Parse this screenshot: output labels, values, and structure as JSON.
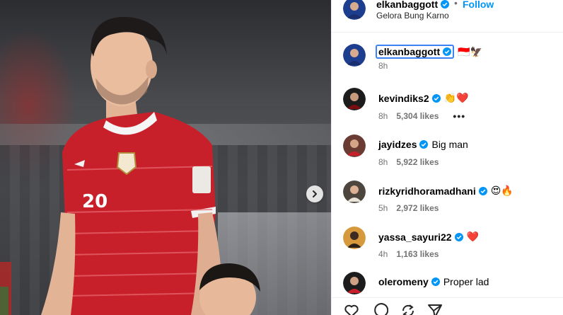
{
  "post": {
    "author": "elkanbaggott",
    "location": "Gelora Bung Karno",
    "follow_label": "Follow",
    "dot": "•",
    "jersey_number": "20",
    "caption_emojis": "🇮🇩🦅",
    "caption_time": "8h"
  },
  "comments": [
    {
      "user": "kevindiks2",
      "text": "👏❤️",
      "time": "8h",
      "likes": "5,304 likes",
      "more": "•••"
    },
    {
      "user": "jayidzes",
      "text": "Big man",
      "time": "8h",
      "likes": "5,922 likes"
    },
    {
      "user": "rizkyridhoramadhani",
      "text": "😍🔥",
      "time": "5h",
      "likes": "2,972 likes"
    },
    {
      "user": "yassa_sayuri22",
      "text": "❤️",
      "time": "4h",
      "likes": "1,163 likes"
    },
    {
      "user": "oleromeny",
      "text": "Proper lad"
    }
  ],
  "colors": {
    "verified": "#0095f6",
    "jersey": "#c8202a",
    "follow": "#0095f6"
  },
  "icons": [
    "verified-badge-icon",
    "chevron-right-icon",
    "heart-icon",
    "comment-icon",
    "share-icon",
    "send-icon"
  ]
}
